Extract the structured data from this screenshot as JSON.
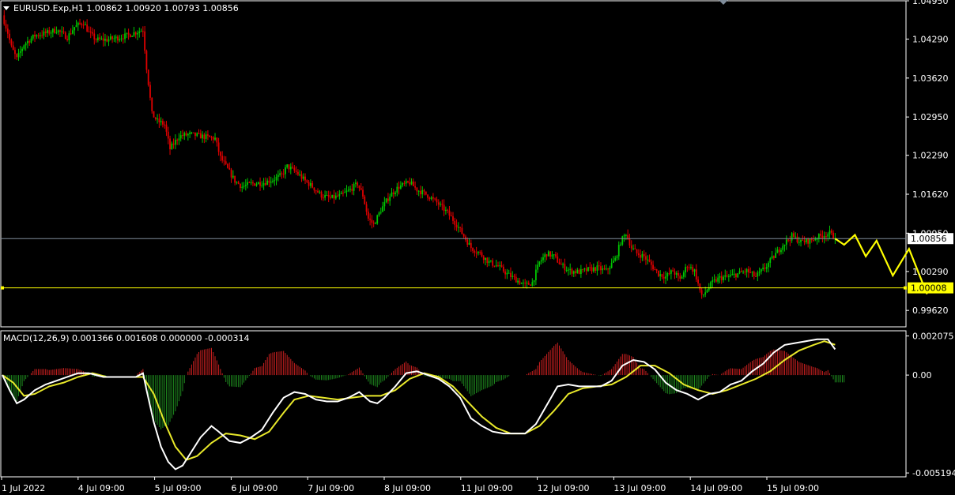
{
  "header": {
    "symbol_line": "EURUSD.Exp,H1  1.00862 1.00920 1.00793 1.00856",
    "collapse_icon": "triangle-down-icon"
  },
  "colors": {
    "background": "#000000",
    "axis": "#ffffff",
    "bull": "#00c800",
    "bear": "#e00000",
    "bid_line": "#7f8c9a",
    "level_line": "#ffff00",
    "forecast": "#ffff00",
    "macd_line": "#ffffff",
    "signal_line": "#e8e82a",
    "hist_pos": "#cc2020",
    "hist_neg": "#1e8a1e"
  },
  "chart_data": [
    {
      "type": "candlestick",
      "title": "EURUSD.Exp,H1",
      "ohlc_current": {
        "open": 1.00862,
        "high": 1.0092,
        "low": 1.00793,
        "close": 1.00856
      },
      "ylim": [
        0.99337,
        1.0495
      ],
      "yticks": [
        "1.04950",
        "1.04290",
        "1.03620",
        "1.02950",
        "1.02290",
        "1.01620",
        "1.00950",
        "1.00290",
        "0.99620"
      ],
      "xticks": [
        "1 Jul 2022",
        "4 Jul 09:00",
        "5 Jul 09:00",
        "6 Jul 09:00",
        "7 Jul 09:00",
        "8 Jul 09:00",
        "11 Jul 09:00",
        "12 Jul 09:00",
        "13 Jul 09:00",
        "14 Jul 09:00",
        "15 Jul 09:00"
      ],
      "current_price": 1.00856,
      "current_price_label": "1.00856",
      "horizontal_level": 1.00008,
      "horizontal_level_label": "1.00008",
      "close_path": [
        [
          0,
          1.047
        ],
        [
          3,
          1.044
        ],
        [
          5,
          1.0415
        ],
        [
          8,
          1.0395
        ],
        [
          12,
          1.042
        ],
        [
          18,
          1.0435
        ],
        [
          25,
          1.044
        ],
        [
          30,
          1.0445
        ],
        [
          36,
          1.0432
        ],
        [
          40,
          1.045
        ],
        [
          45,
          1.0458
        ],
        [
          48,
          1.044
        ],
        [
          52,
          1.0428
        ],
        [
          58,
          1.0428
        ],
        [
          65,
          1.0432
        ],
        [
          70,
          1.0436
        ],
        [
          75,
          1.0442
        ],
        [
          78,
          1.0445
        ],
        [
          80,
          1.038
        ],
        [
          83,
          1.03
        ],
        [
          86,
          1.0288
        ],
        [
          90,
          1.0282
        ],
        [
          93,
          1.024
        ],
        [
          98,
          1.0262
        ],
        [
          104,
          1.0265
        ],
        [
          110,
          1.0262
        ],
        [
          114,
          1.026
        ],
        [
          118,
          1.0258
        ],
        [
          121,
          1.0225
        ],
        [
          125,
          1.0205
        ],
        [
          129,
          1.0185
        ],
        [
          133,
          1.0175
        ],
        [
          138,
          1.018
        ],
        [
          145,
          1.0182
        ],
        [
          150,
          1.0187
        ],
        [
          155,
          1.0195
        ],
        [
          158,
          1.021
        ],
        [
          163,
          1.02
        ],
        [
          168,
          1.0185
        ],
        [
          172,
          1.0175
        ],
        [
          177,
          1.016
        ],
        [
          182,
          1.0155
        ],
        [
          188,
          1.016
        ],
        [
          193,
          1.017
        ],
        [
          197,
          1.018
        ],
        [
          200,
          1.016
        ],
        [
          203,
          1.012
        ],
        [
          206,
          1.011
        ],
        [
          210,
          1.0135
        ],
        [
          215,
          1.016
        ],
        [
          220,
          1.0175
        ],
        [
          226,
          1.0182
        ],
        [
          230,
          1.017
        ],
        [
          236,
          1.016
        ],
        [
          242,
          1.0145
        ],
        [
          247,
          1.013
        ],
        [
          252,
          1.011
        ],
        [
          256,
          1.009
        ],
        [
          260,
          1.007
        ],
        [
          265,
          1.006
        ],
        [
          270,
          1.0045
        ],
        [
          275,
          1.0038
        ],
        [
          280,
          1.0025
        ],
        [
          285,
          1.0015
        ],
        [
          290,
          1.0005
        ],
        [
          294,
          1.001
        ],
        [
          298,
          1.0045
        ],
        [
          302,
          1.006
        ],
        [
          306,
          1.0055
        ],
        [
          310,
          1.004
        ],
        [
          315,
          1.003
        ],
        [
          320,
          1.0028
        ],
        [
          325,
          1.0032
        ],
        [
          330,
          1.0035
        ],
        [
          335,
          1.003
        ],
        [
          340,
          1.005
        ],
        [
          343,
          1.008
        ],
        [
          346,
          1.0095
        ],
        [
          349,
          1.007
        ],
        [
          352,
          1.006
        ],
        [
          356,
          1.0055
        ],
        [
          360,
          1.004
        ],
        [
          364,
          1.0025
        ],
        [
          368,
          1.002
        ],
        [
          372,
          1.003
        ],
        [
          376,
          1.0015
        ],
        [
          380,
          1.004
        ],
        [
          384,
          1.003
        ],
        [
          388,
          0.9985
        ],
        [
          391,
          0.9998
        ],
        [
          394,
          1.001
        ],
        [
          398,
          1.0018
        ],
        [
          403,
          1.002
        ],
        [
          408,
          1.0025
        ],
        [
          413,
          1.003
        ],
        [
          418,
          1.002
        ],
        [
          423,
          1.0035
        ],
        [
          428,
          1.0055
        ],
        [
          433,
          1.0075
        ],
        [
          438,
          1.009
        ],
        [
          443,
          1.008
        ],
        [
          448,
          1.0082
        ],
        [
          452,
          1.0088
        ],
        [
          456,
          1.0092
        ],
        [
          459,
          1.0095
        ],
        [
          462,
          1.00856
        ]
      ],
      "forecast_path": [
        [
          462,
          1.00856
        ],
        [
          467,
          1.0075
        ],
        [
          473,
          1.0092
        ],
        [
          479,
          1.0055
        ],
        [
          485,
          1.0082
        ],
        [
          494,
          1.0022
        ],
        [
          503,
          1.0068
        ],
        [
          513,
          0.999
        ]
      ]
    },
    {
      "type": "histogram+line",
      "title": "MACD(12,26,9) 0.001366 0.001608 0.000000 -0.000314",
      "ylim": [
        -0.0054,
        0.00235
      ],
      "yticks": [
        "0.002075",
        "0.00",
        "-0.005194"
      ],
      "series": [
        {
          "role": "macd",
          "values": [
            [
              0,
              0.0
            ],
            [
              4,
              -0.0008
            ],
            [
              8,
              -0.0015
            ],
            [
              12,
              -0.0013
            ],
            [
              18,
              -0.0008
            ],
            [
              24,
              -0.0005
            ],
            [
              30,
              -0.0003
            ],
            [
              36,
              -0.0001
            ],
            [
              42,
              0.0001
            ],
            [
              48,
              0.0001
            ],
            [
              52,
              0.0
            ],
            [
              56,
              -0.0001
            ],
            [
              62,
              -0.0001
            ],
            [
              68,
              -0.0001
            ],
            [
              74,
              -0.0001
            ],
            [
              78,
              0.0001
            ],
            [
              80,
              -0.0008
            ],
            [
              84,
              -0.0025
            ],
            [
              88,
              -0.0038
            ],
            [
              92,
              -0.0046
            ],
            [
              96,
              -0.005
            ],
            [
              100,
              -0.0048
            ],
            [
              104,
              -0.0042
            ],
            [
              110,
              -0.0033
            ],
            [
              116,
              -0.0027
            ],
            [
              120,
              -0.003
            ],
            [
              126,
              -0.0035
            ],
            [
              132,
              -0.0036
            ],
            [
              138,
              -0.0033
            ],
            [
              144,
              -0.0029
            ],
            [
              150,
              -0.002
            ],
            [
              156,
              -0.0012
            ],
            [
              162,
              -0.0009
            ],
            [
              168,
              -0.001
            ],
            [
              174,
              -0.0013
            ],
            [
              180,
              -0.0014
            ],
            [
              186,
              -0.0014
            ],
            [
              192,
              -0.0012
            ],
            [
              198,
              -0.0009
            ],
            [
              204,
              -0.0014
            ],
            [
              208,
              -0.0015
            ],
            [
              212,
              -0.0012
            ],
            [
              218,
              -0.0006
            ],
            [
              224,
              0.0001
            ],
            [
              230,
              0.0002
            ],
            [
              236,
              0.0
            ],
            [
              242,
              -0.0002
            ],
            [
              248,
              -0.0006
            ],
            [
              254,
              -0.0012
            ],
            [
              260,
              -0.0023
            ],
            [
              266,
              -0.0027
            ],
            [
              272,
              -0.003
            ],
            [
              278,
              -0.0031
            ],
            [
              284,
              -0.0031
            ],
            [
              290,
              -0.0031
            ],
            [
              296,
              -0.0026
            ],
            [
              302,
              -0.0016
            ],
            [
              308,
              -0.0006
            ],
            [
              314,
              -0.0005
            ],
            [
              320,
              -0.0006
            ],
            [
              326,
              -0.0006
            ],
            [
              332,
              -0.0006
            ],
            [
              338,
              -0.0003
            ],
            [
              344,
              0.0005
            ],
            [
              350,
              0.0008
            ],
            [
              356,
              0.0007
            ],
            [
              362,
              0.0003
            ],
            [
              368,
              -0.0004
            ],
            [
              374,
              -0.0008
            ],
            [
              380,
              -0.001
            ],
            [
              386,
              -0.0013
            ],
            [
              392,
              -0.001
            ],
            [
              398,
              -0.0009
            ],
            [
              404,
              -0.0005
            ],
            [
              410,
              -0.0003
            ],
            [
              416,
              0.0002
            ],
            [
              422,
              0.0006
            ],
            [
              428,
              0.0012
            ],
            [
              434,
              0.0016
            ],
            [
              440,
              0.0017
            ],
            [
              446,
              0.0018
            ],
            [
              452,
              0.0019
            ],
            [
              458,
              0.0019
            ],
            [
              462,
              0.001366
            ]
          ]
        },
        {
          "role": "signal",
          "values": [
            [
              0,
              0.0
            ],
            [
              6,
              -0.0004
            ],
            [
              12,
              -0.0011
            ],
            [
              18,
              -0.001
            ],
            [
              26,
              -0.0006
            ],
            [
              34,
              -0.0004
            ],
            [
              42,
              -0.0001
            ],
            [
              50,
              0.0001
            ],
            [
              58,
              -0.0001
            ],
            [
              66,
              -0.0001
            ],
            [
              74,
              -0.0001
            ],
            [
              78,
              -0.0001
            ],
            [
              84,
              -0.001
            ],
            [
              90,
              -0.0025
            ],
            [
              96,
              -0.0038
            ],
            [
              102,
              -0.0045
            ],
            [
              108,
              -0.0043
            ],
            [
              116,
              -0.0036
            ],
            [
              124,
              -0.0031
            ],
            [
              132,
              -0.0032
            ],
            [
              140,
              -0.0034
            ],
            [
              148,
              -0.003
            ],
            [
              156,
              -0.002
            ],
            [
              162,
              -0.0013
            ],
            [
              170,
              -0.0011
            ],
            [
              178,
              -0.0012
            ],
            [
              186,
              -0.0013
            ],
            [
              194,
              -0.0012
            ],
            [
              202,
              -0.0011
            ],
            [
              210,
              -0.0011
            ],
            [
              218,
              -0.0008
            ],
            [
              226,
              -0.0002
            ],
            [
              234,
              0.0001
            ],
            [
              242,
              -0.0001
            ],
            [
              250,
              -0.0006
            ],
            [
              258,
              -0.0014
            ],
            [
              266,
              -0.0022
            ],
            [
              274,
              -0.0028
            ],
            [
              282,
              -0.0031
            ],
            [
              290,
              -0.0031
            ],
            [
              298,
              -0.0027
            ],
            [
              306,
              -0.0019
            ],
            [
              314,
              -0.001
            ],
            [
              322,
              -0.0007
            ],
            [
              330,
              -0.0006
            ],
            [
              338,
              -0.0005
            ],
            [
              346,
              -0.0001
            ],
            [
              354,
              0.0005
            ],
            [
              362,
              0.0005
            ],
            [
              370,
              0.0001
            ],
            [
              378,
              -0.0005
            ],
            [
              386,
              -0.0008
            ],
            [
              394,
              -0.001
            ],
            [
              402,
              -0.0008
            ],
            [
              410,
              -0.0005
            ],
            [
              418,
              -0.0002
            ],
            [
              426,
              0.0002
            ],
            [
              434,
              0.0008
            ],
            [
              442,
              0.0013
            ],
            [
              450,
              0.0016
            ],
            [
              456,
              0.0018
            ],
            [
              462,
              0.001608
            ]
          ]
        }
      ]
    }
  ]
}
